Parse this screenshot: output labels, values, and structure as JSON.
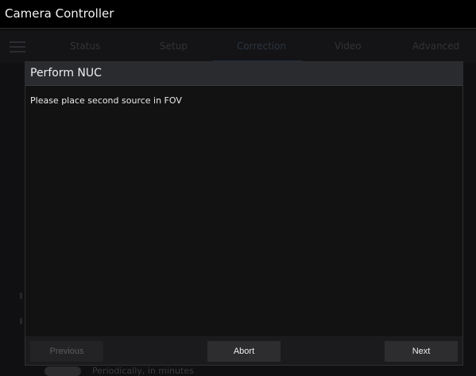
{
  "window": {
    "title": "Camera Controller"
  },
  "nav": {
    "tabs": [
      {
        "label": "Status"
      },
      {
        "label": "Setup"
      },
      {
        "label": "Correction"
      },
      {
        "label": "Video"
      },
      {
        "label": "Advanced"
      }
    ],
    "active_tab": "Correction"
  },
  "background": {
    "row_label": "Periodically, in minutes"
  },
  "dialog": {
    "title": "Perform NUC",
    "message": "Please place second source in FOV",
    "buttons": {
      "previous": "Previous",
      "abort": "Abort",
      "next": "Next"
    }
  }
}
